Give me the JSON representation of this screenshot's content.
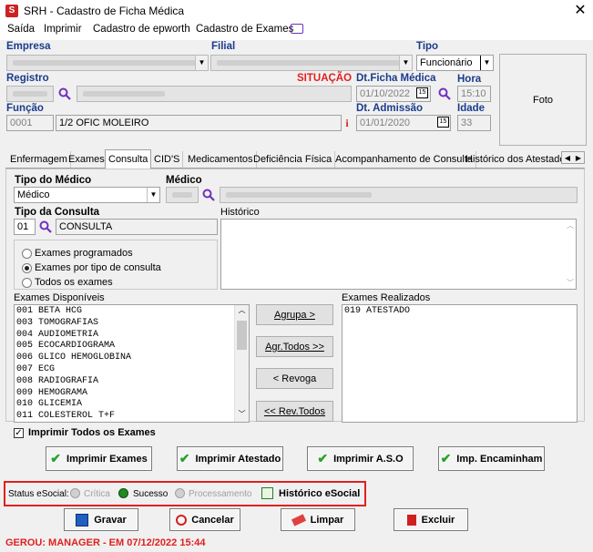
{
  "window": {
    "title": "SRH - Cadastro de Ficha Médica",
    "app_icon": "srh-app-icon"
  },
  "menu": [
    {
      "label": "Saída"
    },
    {
      "label": "Imprimir"
    },
    {
      "label": "Cadastro de epworth"
    },
    {
      "label": "Cadastro de Exames"
    }
  ],
  "header": {
    "empresa_label": "Empresa",
    "filial_label": "Filial",
    "tipo_label": "Tipo",
    "tipo_value": "Funcionário",
    "registro_label": "Registro",
    "situacao_label": "SITUAÇÃO",
    "dt_ficha_label": "Dt.Ficha Médica",
    "dt_ficha_value": "01/10/2022",
    "hora_label": "Hora",
    "hora_value": "15:10",
    "funcao_label": "Função",
    "funcao_code": "0001",
    "funcao_value": "1/2 OFIC MOLEIRO",
    "info_icon_text": "i",
    "dt_admissao_label": "Dt. Admissão",
    "dt_admissao_value": "01/01/2020",
    "idade_label": "Idade",
    "idade_value": "33",
    "foto_label": "Foto",
    "cal_icon_text": "15"
  },
  "tabs": [
    {
      "label": "Enfermagem"
    },
    {
      "label": "Exames"
    },
    {
      "label": "Consulta",
      "active": true
    },
    {
      "label": "CID'S"
    },
    {
      "label": "Medicamentos"
    },
    {
      "label": "Deficiência Física"
    },
    {
      "label": "Acompanhamento de Consulta"
    },
    {
      "label": "Histórico dos Atestados"
    }
  ],
  "consulta": {
    "tipo_medico_label": "Tipo do Médico",
    "tipo_medico_value": "Médico",
    "medico_label": "Médico",
    "tipo_consulta_label": "Tipo da Consulta",
    "tipo_consulta_code": "01",
    "tipo_consulta_value": "CONSULTA",
    "historico_label": "Histórico",
    "radios": [
      {
        "label": "Exames programados",
        "checked": false
      },
      {
        "label": "Exames por tipo de consulta",
        "checked": true
      },
      {
        "label": "Todos os exames",
        "checked": false
      }
    ],
    "exames_disponiveis_label": "Exames Disponíveis",
    "exames_disponiveis": [
      "001 BETA HCG",
      "003 TOMOGRAFIAS",
      "004 AUDIOMETRIA",
      "005 ECOCARDIOGRAMA",
      "006 GLICO HEMOGLOBINA",
      "007 ECG",
      "008 RADIOGRAFIA",
      "009 HEMOGRAMA",
      "010 GLICEMIA",
      "011 COLESTEROL T+F"
    ],
    "exames_realizados_label": "Exames Realizados",
    "exames_realizados": [
      "019 ATESTADO"
    ],
    "buttons": {
      "agrupa": "Agrupa >",
      "agr_todos": "Agr.Todos >>",
      "revoga": "< Revoga",
      "rev_todos": "<< Rev.Todos"
    },
    "imprimir_todos_label": "Imprimir Todos os Exames",
    "imprimir_todos_checked": true
  },
  "print_buttons": [
    {
      "label": "Imprimir Exames"
    },
    {
      "label": "Imprimir Atestado"
    },
    {
      "label": "Imprimir A.S.O"
    },
    {
      "label": "Imp. Encaminham"
    }
  ],
  "esocial": {
    "status_label": "Status eSocial:",
    "critica": "Crítica",
    "sucesso": "Sucesso",
    "processamento": "Processamento",
    "historico": "Histórico eSocial",
    "sucesso_color": "#1f8a1f"
  },
  "actions": {
    "gravar": "Gravar",
    "cancelar": "Cancelar",
    "limpar": "Limpar",
    "excluir": "Excluir"
  },
  "footer": {
    "text": "GEROU: MANAGER - EM 07/12/2022 15:44"
  },
  "colors": {
    "label_blue": "#1a3b8c",
    "accent_red": "#e02020",
    "search_purple": "#7030c0"
  }
}
